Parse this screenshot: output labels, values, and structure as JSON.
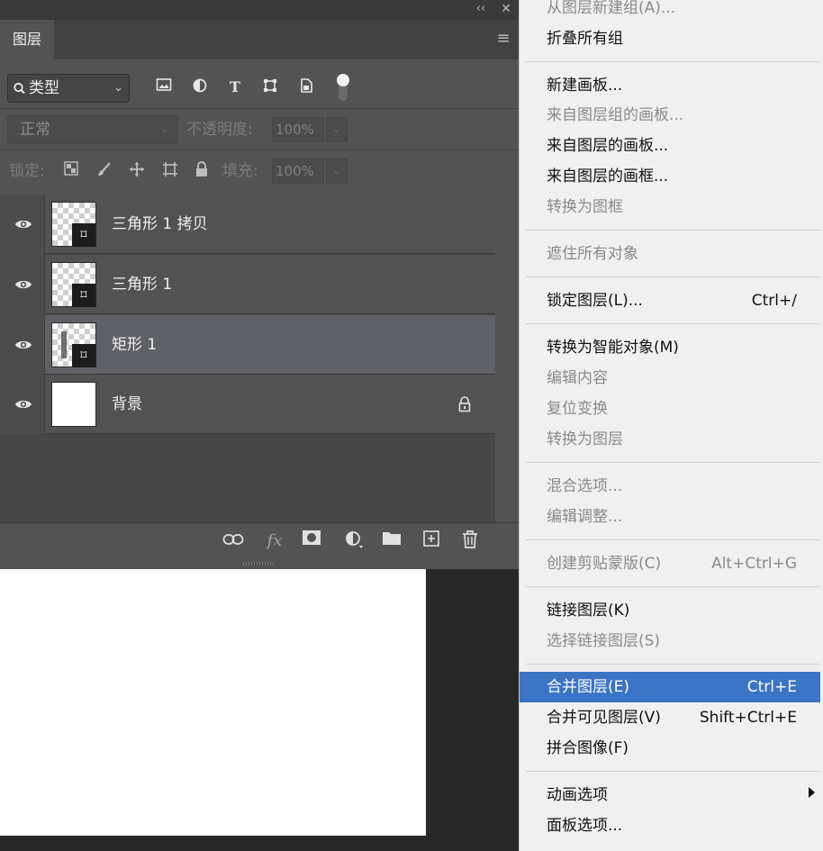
{
  "panel": {
    "tab_title": "图层",
    "collapse_glyph": "‹‹",
    "close_glyph": "✕",
    "filter": {
      "label": "类型"
    },
    "blend_mode": "正常",
    "opacity_label": "不透明度:",
    "opacity_value": "100%",
    "lock_label": "锁定:",
    "fill_label": "填充:",
    "fill_value": "100%",
    "layers": [
      {
        "name": "三角形 1 拷贝",
        "visible": true,
        "selected": false,
        "type": "shape"
      },
      {
        "name": "三角形 1",
        "visible": true,
        "selected": false,
        "type": "shape"
      },
      {
        "name": "矩形 1",
        "visible": true,
        "selected": true,
        "type": "shape"
      },
      {
        "name": "背景",
        "visible": true,
        "selected": false,
        "type": "background",
        "locked": true
      }
    ],
    "footer_icons": [
      "link-icon",
      "fx-icon",
      "mask-icon",
      "adjustment-icon",
      "folder-icon",
      "new-layer-icon",
      "trash-icon"
    ],
    "fx_label": "fx"
  },
  "menu": {
    "items": [
      {
        "label": "从图层新建组(A)...",
        "enabled": false
      },
      {
        "label": "折叠所有组",
        "enabled": true
      },
      {
        "label": "新建画板...",
        "enabled": true
      },
      {
        "label": "来自图层组的画板...",
        "enabled": false
      },
      {
        "label": "来自图层的画板...",
        "enabled": true
      },
      {
        "label": "来自图层的画框...",
        "enabled": true
      },
      {
        "label": "转换为图框",
        "enabled": false
      },
      {
        "label": "遮住所有对象",
        "enabled": false
      },
      {
        "label": "锁定图层(L)...",
        "shortcut": "Ctrl+/",
        "enabled": true
      },
      {
        "label": "转换为智能对象(M)",
        "enabled": true
      },
      {
        "label": "编辑内容",
        "enabled": false
      },
      {
        "label": "复位变换",
        "enabled": false
      },
      {
        "label": "转换为图层",
        "enabled": false
      },
      {
        "label": "混合选项...",
        "enabled": false
      },
      {
        "label": "编辑调整...",
        "enabled": false
      },
      {
        "label": "创建剪贴蒙版(C)",
        "shortcut": "Alt+Ctrl+G",
        "enabled": false
      },
      {
        "label": "链接图层(K)",
        "enabled": true
      },
      {
        "label": "选择链接图层(S)",
        "enabled": false
      },
      {
        "label": "合并图层(E)",
        "shortcut": "Ctrl+E",
        "enabled": true,
        "highlighted": true
      },
      {
        "label": "合并可见图层(V)",
        "shortcut": "Shift+Ctrl+E",
        "enabled": true
      },
      {
        "label": "拼合图像(F)",
        "enabled": true
      },
      {
        "label": "动画选项",
        "enabled": true,
        "submenu": true
      },
      {
        "label": "面板选项...",
        "enabled": true
      }
    ]
  },
  "colors": {
    "menu_highlight": "#3b74c5",
    "panel_bg": "#535353",
    "selected_layer": "#5f6167"
  }
}
